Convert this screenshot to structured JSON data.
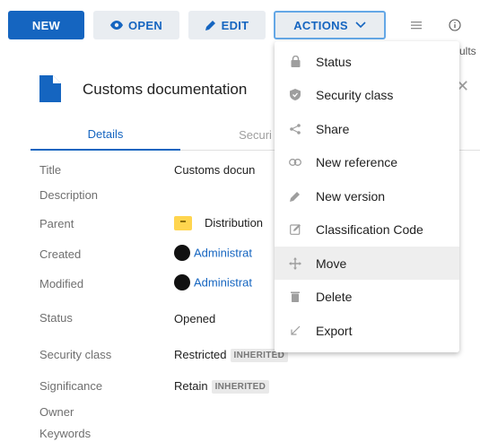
{
  "toolbar": {
    "new_label": "NEW",
    "open_label": "OPEN",
    "edit_label": "EDIT",
    "actions_label": "ACTIONS",
    "results_partial": "ults"
  },
  "document": {
    "title": "Customs documentation",
    "icon": "document-icon"
  },
  "tabs": [
    {
      "label": "Details",
      "active": true
    },
    {
      "label": "Securi",
      "active": false
    }
  ],
  "fields": [
    {
      "label": "Title",
      "value": "Customs docun"
    },
    {
      "label": "Description",
      "value": ""
    },
    {
      "label": "Parent",
      "value": "Distribution"
    },
    {
      "label": "Created",
      "value": "Administrat"
    },
    {
      "label": "Modified",
      "value": "Administrat"
    },
    {
      "label": "Status",
      "value": "Opened"
    },
    {
      "label": "Security class",
      "value": "Restricted",
      "badge": "INHERITED"
    },
    {
      "label": "Significance",
      "value": "Retain",
      "badge": "INHERITED"
    },
    {
      "label": "Owner",
      "value": ""
    },
    {
      "label": "Keywords",
      "value": ""
    }
  ],
  "actions_menu": {
    "items": [
      {
        "label": "Status",
        "icon": "lock-icon"
      },
      {
        "label": "Security class",
        "icon": "shield-icon"
      },
      {
        "label": "Share",
        "icon": "share-icon"
      },
      {
        "label": "New reference",
        "icon": "link-icon"
      },
      {
        "label": "New version",
        "icon": "pencil-icon"
      },
      {
        "label": "Classification Code",
        "icon": "edit-box-icon"
      },
      {
        "label": "Move",
        "icon": "move-icon",
        "hovered": true
      },
      {
        "label": "Delete",
        "icon": "trash-icon"
      },
      {
        "label": "Export",
        "icon": "export-arrow-icon"
      }
    ]
  },
  "colors": {
    "primary": "#1565c0",
    "button_bg": "#e9edf1",
    "focus_border": "#64a7e6",
    "folder": "#ffd54f"
  }
}
